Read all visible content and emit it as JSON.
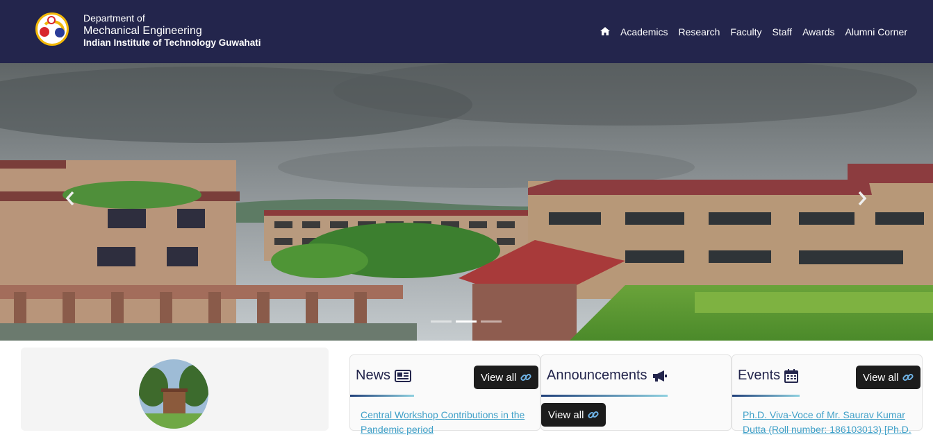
{
  "header": {
    "dept_line1": "Department of",
    "dept_line2": "Mechanical Engineering",
    "institute": "Indian Institute of Technology Guwahati",
    "nav": [
      {
        "label": "Academics"
      },
      {
        "label": "Research"
      },
      {
        "label": "Faculty"
      },
      {
        "label": "Staff"
      },
      {
        "label": "Awards"
      },
      {
        "label": "Alumni Corner"
      }
    ],
    "home_icon": "home-icon",
    "bg_color": "#23254c"
  },
  "carousel": {
    "slide_count": 3,
    "active_index": 1,
    "prev_icon": "chevron-left-icon",
    "next_icon": "chevron-right-icon"
  },
  "panels": {
    "news": {
      "title": "News",
      "icon": "newspaper-icon",
      "view_all": "View all",
      "first_item": "Central Workshop Contributions in the Pandemic period"
    },
    "announcements": {
      "title": "Announcements",
      "icon": "megaphone-icon",
      "view_all": "View all"
    },
    "events": {
      "title": "Events",
      "icon": "calendar-icon",
      "view_all": "View all",
      "first_item": "Ph.D. Viva-Voce of Mr. Saurav Kumar Dutta (Roll number: 186103013) [Ph.D."
    }
  }
}
